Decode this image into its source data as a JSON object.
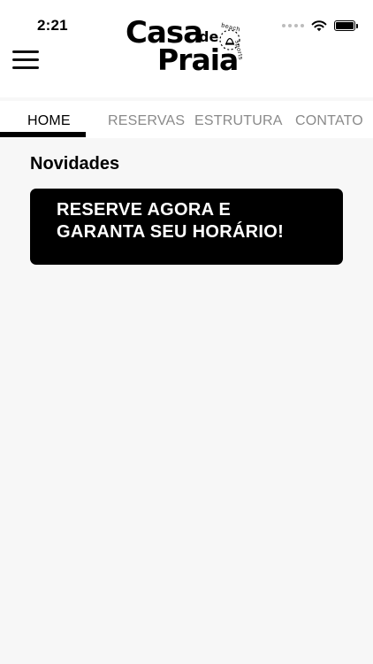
{
  "status_bar": {
    "time": "2:21"
  },
  "header": {
    "logo": {
      "line1": "Casa",
      "de": "de",
      "line2": "Praia",
      "tagline_1": "beach",
      "tagline_2": "sports"
    }
  },
  "tabs": [
    {
      "label": "HOME",
      "active": true
    },
    {
      "label": "RESERVAS",
      "active": false
    },
    {
      "label": "ESTRUTURA",
      "active": false
    },
    {
      "label": "CONTATO",
      "active": false
    }
  ],
  "main": {
    "section_title": "Novidades",
    "banner": {
      "line1": "RESERVE AGORA E",
      "line2": "GARANTA SEU HORÁRIO!"
    }
  },
  "icons": {
    "menu": "hamburger-menu-icon",
    "wifi": "wifi-icon",
    "battery": "battery-icon",
    "signal": "cellular-signal-icon"
  },
  "colors": {
    "background": "#f7f7f7",
    "header": "#ffffff",
    "tab_inactive": "#8a8a8a",
    "tab_active": "#000000",
    "banner": "#000000",
    "banner_text": "#ffffff"
  }
}
